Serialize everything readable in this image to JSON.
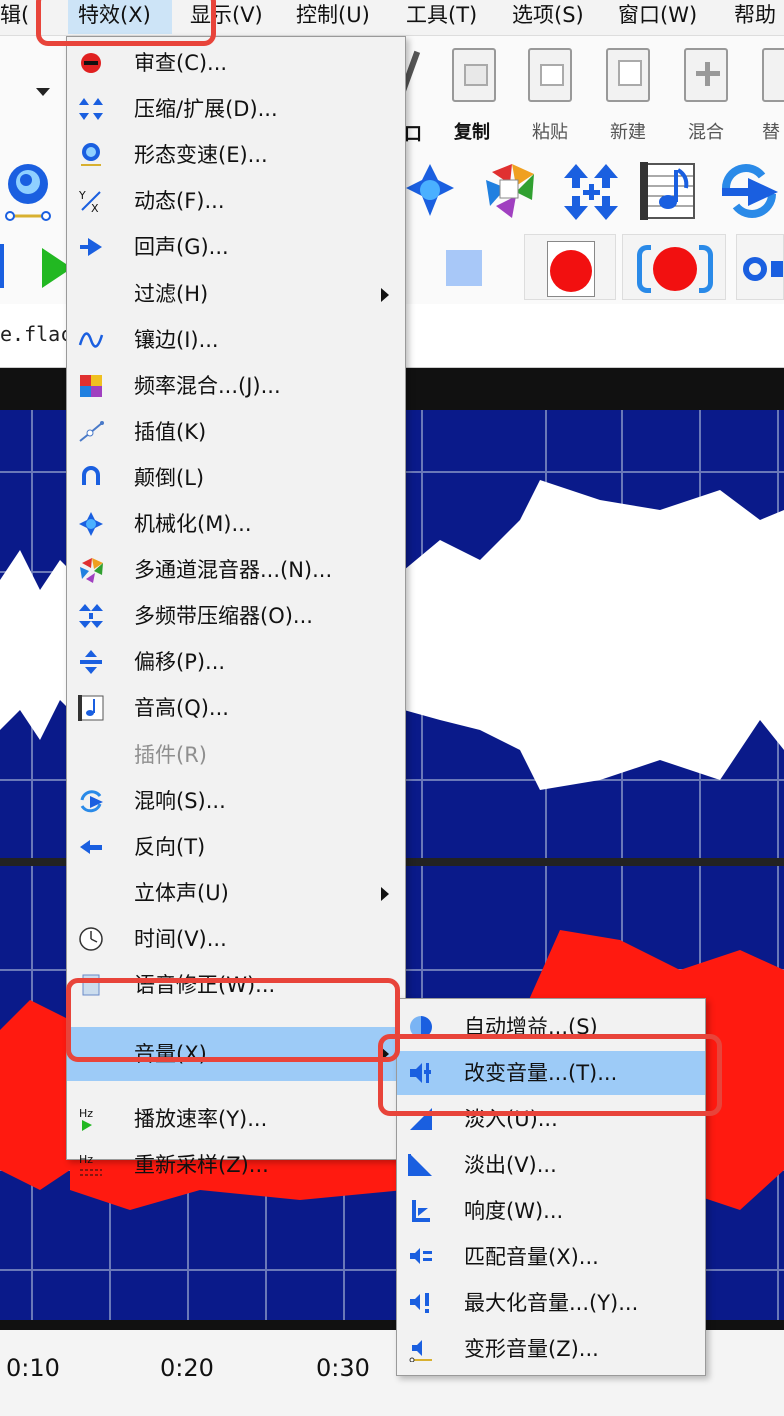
{
  "menubar": {
    "items": [
      "辑(",
      "特效(X)",
      "显示(V)",
      "控制(U)",
      "工具(T)",
      "选项(S)",
      "窗口(W)",
      "帮助"
    ]
  },
  "toolbar": {
    "copy_label": "复制",
    "paste_label": "粘贴",
    "new_label": "新建",
    "mix_label": "混合",
    "extra_label": "替"
  },
  "tab": {
    "filename": "e.flac"
  },
  "ruler": {
    "ticks": [
      "0:10",
      "0:20",
      "0:30"
    ]
  },
  "effects_menu": {
    "items": [
      {
        "label": "审查(C)...",
        "icon": "censor-icon"
      },
      {
        "label": "压缩/扩展(D)...",
        "icon": "compress-icon"
      },
      {
        "label": "形态变速(E)...",
        "icon": "morph-icon"
      },
      {
        "label": "动态(F)...",
        "icon": "dynamics-icon"
      },
      {
        "label": "回声(G)...",
        "icon": "echo-icon"
      },
      {
        "label": "过滤(H)",
        "icon": "",
        "submenu": true
      },
      {
        "label": "镶边(I)...",
        "icon": "flange-icon"
      },
      {
        "label": "频率混合...(J)...",
        "icon": "frequency-mix-icon"
      },
      {
        "label": "插值(K)",
        "icon": "interpolate-icon"
      },
      {
        "label": "颠倒(L)",
        "icon": "invert-icon"
      },
      {
        "label": "机械化(M)...",
        "icon": "mechanize-icon"
      },
      {
        "label": "多通道混音器...(N)...",
        "icon": "multichannel-mixer-icon"
      },
      {
        "label": "多频带压缩器(O)...",
        "icon": "multiband-compressor-icon"
      },
      {
        "label": "偏移(P)...",
        "icon": "offset-icon"
      },
      {
        "label": "音高(Q)...",
        "icon": "pitch-icon"
      },
      {
        "label": "插件(R)",
        "icon": "",
        "disabled": true
      },
      {
        "label": "混响(S)...",
        "icon": "reverb-icon"
      },
      {
        "label": "反向(T)",
        "icon": "reverse-icon"
      },
      {
        "label": "立体声(U)",
        "icon": "",
        "submenu": true
      },
      {
        "label": "时间(V)...",
        "icon": "clock-icon"
      },
      {
        "label": "语音修正(W)...",
        "icon": "voice-icon"
      },
      {
        "label": "音量(X)",
        "icon": "",
        "submenu": true,
        "highlighted": true
      },
      {
        "label": "播放速率(Y)...",
        "icon": "playback-rate-icon"
      },
      {
        "label": "重新采样(Z)...",
        "icon": "resample-icon"
      }
    ]
  },
  "volume_submenu": {
    "items": [
      {
        "label": "自动增益...(S)",
        "icon": "auto-gain-icon"
      },
      {
        "label": "改变音量...(T)...",
        "icon": "change-volume-icon",
        "highlighted": true
      },
      {
        "label": "淡入(U)...",
        "icon": "fade-in-icon"
      },
      {
        "label": "淡出(V)...",
        "icon": "fade-out-icon"
      },
      {
        "label": "响度(W)...",
        "icon": "loudness-icon"
      },
      {
        "label": "匹配音量(X)...",
        "icon": "match-volume-icon"
      },
      {
        "label": "最大化音量...(Y)...",
        "icon": "maximize-volume-icon"
      },
      {
        "label": "变形音量(Z)...",
        "icon": "envelope-volume-icon"
      }
    ]
  },
  "colors": {
    "wave_background": "#0a1a8a",
    "wave_white": "#ffffff",
    "wave_red": "#ff1a10",
    "menu_highlight": "#9dcbf7",
    "callout": "#e8443a",
    "icon_blue": "#1a5fe0"
  }
}
